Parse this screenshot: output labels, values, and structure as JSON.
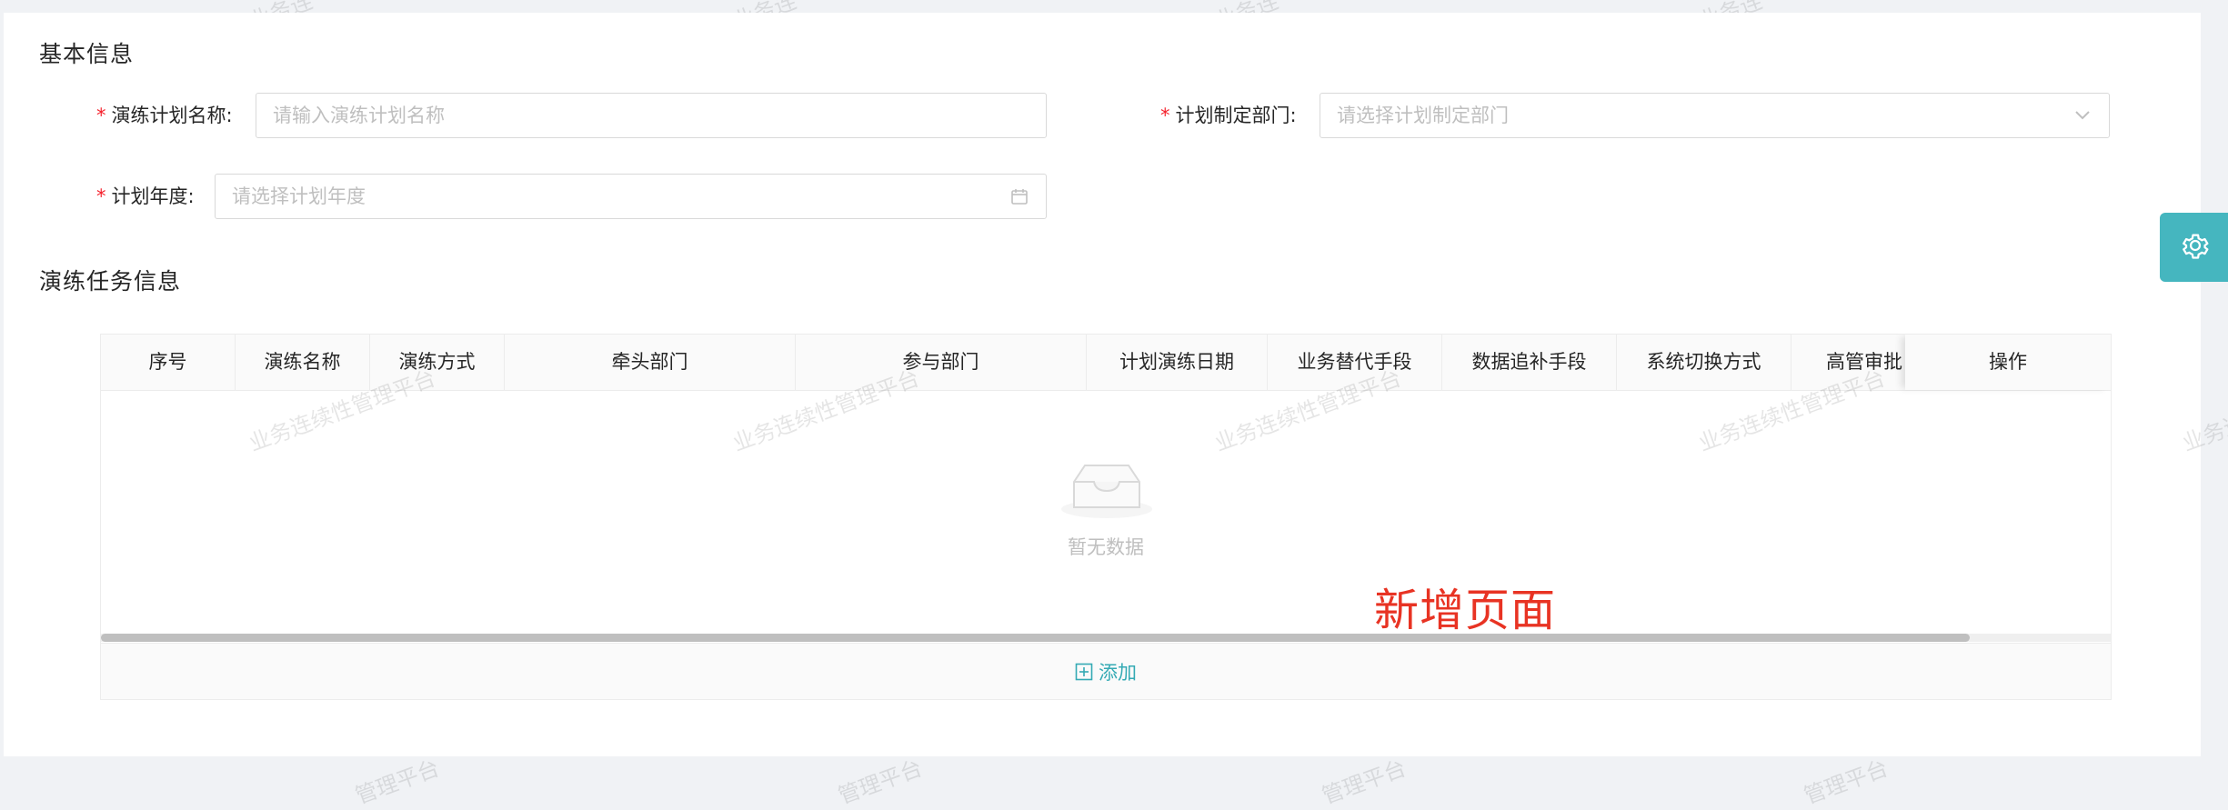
{
  "basic_info": {
    "title": "基本信息",
    "plan_name": {
      "label": "演练计划名称:",
      "placeholder": "请输入演练计划名称"
    },
    "department": {
      "label": "计划制定部门:",
      "placeholder": "请选择计划制定部门"
    },
    "year": {
      "label": "计划年度:",
      "placeholder": "请选择计划年度"
    }
  },
  "task_info": {
    "title": "演练任务信息",
    "columns": [
      "序号",
      "演练名称",
      "演练方式",
      "牵头部门",
      "参与部门",
      "计划演练日期",
      "业务替代手段",
      "数据追补手段",
      "系统切换方式",
      "高管审批"
    ],
    "action_column": "操作",
    "empty_text": "暂无数据",
    "add_label": "添加",
    "scroll_fraction": 0.93
  },
  "annotation": "新增页面",
  "watermark": {
    "full": "业务连续性管理平台",
    "top_fragment": "业务连",
    "bottom_fragment": "管理平台",
    "edge_fragment": "业务连"
  },
  "colors": {
    "accent": "#34aab4",
    "settings_tab": "#45b6bf",
    "required": "#f5222d",
    "annotation": "#e83323"
  },
  "icons": {
    "settings": "gear-icon",
    "dropdown": "chevron-down-icon",
    "date": "calendar-icon",
    "empty": "inbox-icon",
    "add": "plus-square-icon"
  }
}
